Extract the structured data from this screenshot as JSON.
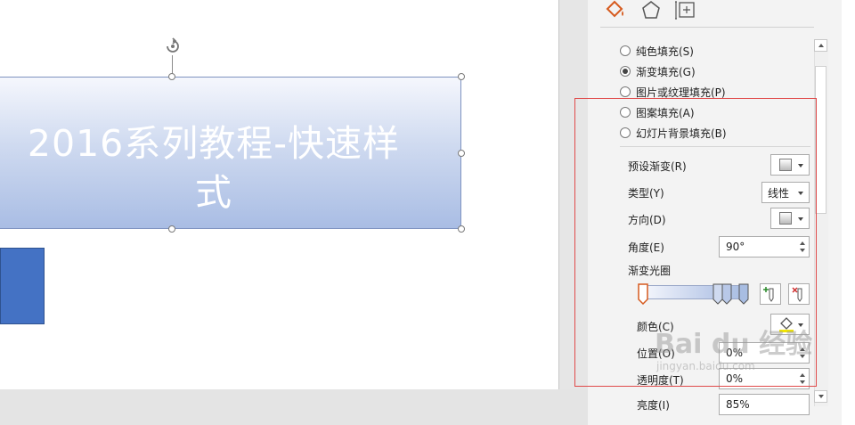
{
  "slide": {
    "title_text": "2016系列教程-快速样\n式"
  },
  "pane": {
    "tabs": [
      {
        "icon": "fill-bucket-icon"
      },
      {
        "icon": "pentagon-icon"
      },
      {
        "icon": "size-layout-icon"
      }
    ],
    "fill_options": [
      {
        "label": "纯色填充(S)",
        "selected": false
      },
      {
        "label": "渐变填充(G)",
        "selected": true
      },
      {
        "label": "图片或纹理填充(P)",
        "selected": false
      },
      {
        "label": "图案填充(A)",
        "selected": false
      },
      {
        "label": "幻灯片背景填充(B)",
        "selected": false
      }
    ],
    "preset_gradient_label": "预设渐变(R)",
    "type_label": "类型(Y)",
    "type_value": "线性",
    "direction_label": "方向(D)",
    "angle_label": "角度(E)",
    "angle_value": "90°",
    "gradient_stops_label": "渐变光圈",
    "color_label": "颜色(C)",
    "position_label": "位置(O)",
    "position_value": "0%",
    "transparency_label": "透明度(T)",
    "transparency_value": "0%",
    "brightness_label": "亮度(I)",
    "brightness_value": "85%"
  },
  "colors": {
    "accent_blue": "#4472c4",
    "highlight_red": "#e04a4a",
    "fill_tab_orange": "#d65a1e"
  },
  "watermark": {
    "line1": "Bai du 经验",
    "line2": "jingyan.baidu.com"
  }
}
